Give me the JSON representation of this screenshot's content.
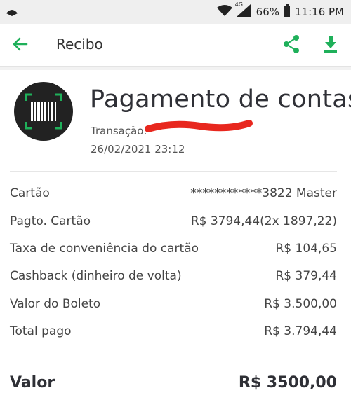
{
  "status_bar": {
    "network": "4G",
    "battery": "66%",
    "time": "11:16 PM"
  },
  "app_bar": {
    "title": "Recibo",
    "icons": [
      "back-arrow-icon",
      "share-icon",
      "download-icon"
    ]
  },
  "header": {
    "title": "Pagamento de contas",
    "transaction_label": "Transação:",
    "date": "26/02/2021 23:12",
    "icon": "barcode-icon"
  },
  "details": [
    {
      "label": "Cartão",
      "value": "************3822 Master"
    },
    {
      "label": "Pagto. Cartão",
      "value": "R$ 3794,44(2x 1897,22)"
    },
    {
      "label": "Taxa de conveniência do cartão",
      "value": "R$ 104,65"
    },
    {
      "label": "Cashback (dinheiro de volta)",
      "value": "R$ 379,44"
    },
    {
      "label": "Valor do Boleto",
      "value": "R$ 3.500,00"
    },
    {
      "label": "Total pago",
      "value": "R$ 3.794,44"
    }
  ],
  "total": {
    "label": "Valor",
    "value": "R$ 3500,00"
  },
  "colors": {
    "accent": "#1fb05a",
    "redaction": "#e8271e",
    "logo_bg": "#222222"
  }
}
